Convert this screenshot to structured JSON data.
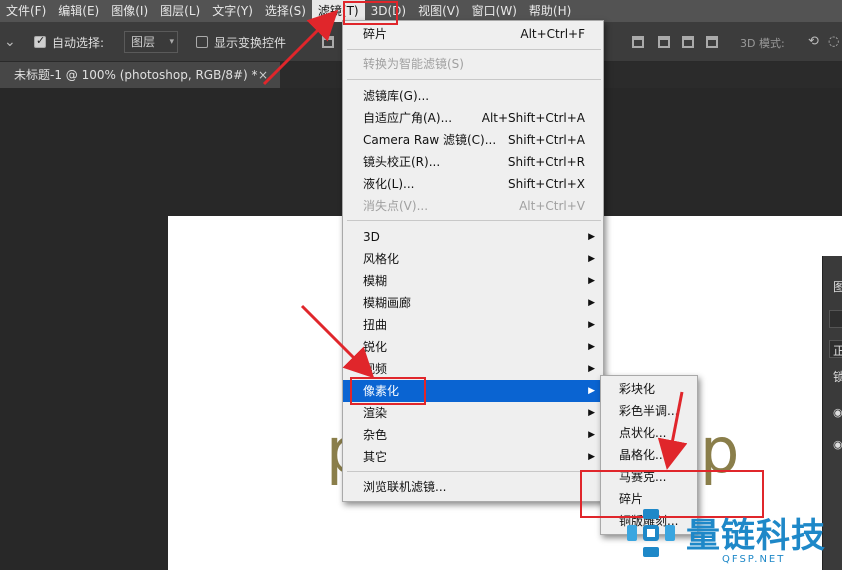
{
  "menubar": {
    "items": [
      "文件(F)",
      "编辑(E)",
      "图像(I)",
      "图层(L)",
      "文字(Y)",
      "选择(S)",
      "滤镜(T)",
      "3D(D)",
      "视图(V)",
      "窗口(W)",
      "帮助(H)"
    ]
  },
  "options": {
    "auto_select_label": "自动选择:",
    "layer_dropdown": "图层",
    "show_transform_label": "显示变换控件",
    "mode_3d_label": "3D 模式:"
  },
  "document": {
    "tab_title": "未标题-1 @ 100% (photoshop, RGB/8#) *",
    "close_glyph": "×",
    "canvas_text_left": "p",
    "canvas_text_right": "p"
  },
  "filter_menu": {
    "last_filter": {
      "label": "碎片",
      "shortcut": "Alt+Ctrl+F"
    },
    "convert_smart": "转换为智能滤镜(S)",
    "gallery": "滤镜库(G)...",
    "adaptive_wide": {
      "label": "自适应广角(A)...",
      "shortcut": "Alt+Shift+Ctrl+A"
    },
    "camera_raw": {
      "label": "Camera Raw 滤镜(C)...",
      "shortcut": "Shift+Ctrl+A"
    },
    "lens_correction": {
      "label": "镜头校正(R)...",
      "shortcut": "Shift+Ctrl+R"
    },
    "liquify": {
      "label": "液化(L)...",
      "shortcut": "Shift+Ctrl+X"
    },
    "vanishing_point": {
      "label": "消失点(V)...",
      "shortcut": "Alt+Ctrl+V"
    },
    "submenus": [
      "3D",
      "风格化",
      "模糊",
      "模糊画廊",
      "扭曲",
      "锐化",
      "视频",
      "像素化",
      "渲染",
      "杂色",
      "其它"
    ],
    "browse_online": "浏览联机滤镜..."
  },
  "pixelate_submenu": {
    "items": [
      "彩块化",
      "彩色半调...",
      "点状化...",
      "晶格化...",
      "马赛克...",
      "碎片",
      "铜版雕刻..."
    ]
  },
  "right_panel": {
    "header": "图",
    "mode": "正",
    "lock": "锁"
  },
  "watermark": {
    "name": "量链科技",
    "domain": "QFSP.NET"
  },
  "colors": {
    "highlight": "#0a64d2",
    "annotation_red": "#e0262b",
    "watermark_blue": "#1e88c8",
    "canvas_text": "#8a7e4a"
  }
}
